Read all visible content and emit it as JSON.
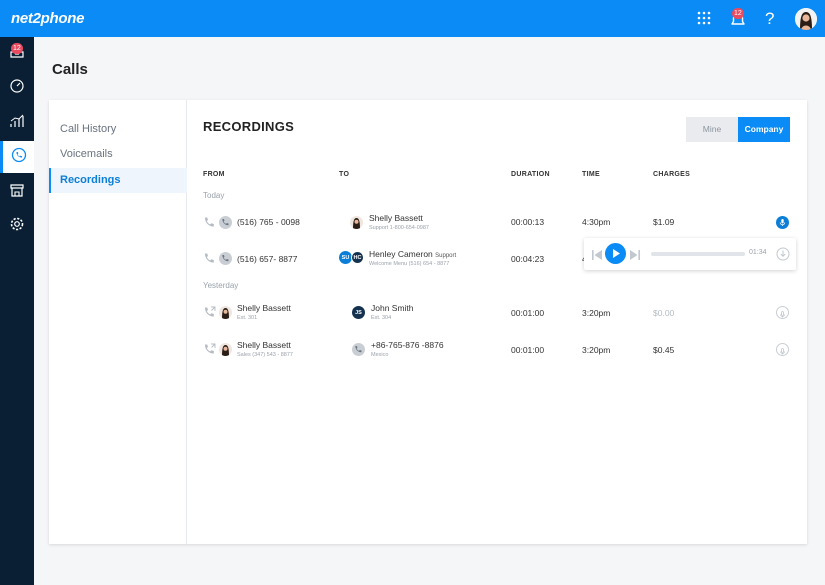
{
  "header": {
    "logo": "net2phone",
    "notification_count": "12",
    "help_label": "?"
  },
  "sidebar": {
    "inbox_badge": "12"
  },
  "page": {
    "title": "Calls"
  },
  "subnav": {
    "items": [
      {
        "label": "Call History"
      },
      {
        "label": "Voicemails"
      },
      {
        "label": "Recordings"
      }
    ]
  },
  "recordings": {
    "title": "RECORDINGS",
    "toggle": {
      "mine": "Mine",
      "company": "Company"
    },
    "columns": {
      "from": "FROM",
      "to": "TO",
      "duration": "DURATION",
      "time": "TIME",
      "charges": "CHARGES"
    },
    "groups": {
      "today": "Today",
      "yesterday": "Yesterday"
    },
    "rows": [
      {
        "from_name": "(516) 765 - 0098",
        "from_sub": "",
        "to_name": "Shelly Bassett",
        "to_sub": "Support 1-800-654-0987",
        "duration": "00:00:13",
        "time": "4:30pm",
        "charges": "$1.09"
      },
      {
        "from_name": "(516) 657- 8877",
        "from_sub": "",
        "to_name": "Henley Cameron",
        "to_tag": "Support",
        "to_sub": "Welcome Menu (516) 654 - 8877",
        "to_initials_a": "SU",
        "to_initials_b": "HC",
        "duration": "00:04:23",
        "time": "4",
        "charges": ""
      },
      {
        "from_name": "Shelly Bassett",
        "from_sub": "Ext. 301",
        "to_name": "John Smith",
        "to_sub": "Ext. 304",
        "to_initials": "JS",
        "duration": "00:01:00",
        "time": "3:20pm",
        "charges": "$0.00"
      },
      {
        "from_name": "Shelly Bassett",
        "from_sub": "Sales (347) 543 - 8877",
        "to_name": "+86-765-876 -8876",
        "to_sub": "Mexico",
        "duration": "00:01:00",
        "time": "3:20pm",
        "charges": "$0.45"
      }
    ]
  },
  "player": {
    "time": "01:34",
    "progress": 0.0
  },
  "colors": {
    "brand": "#0b8bf5",
    "sidebar": "#0a1f33",
    "badge": "#e84a5f"
  },
  "icons": [
    "grid-icon",
    "bell-icon",
    "help-icon",
    "inbox-icon",
    "dashboard-icon",
    "analytics-icon",
    "phone-icon",
    "store-icon",
    "settings-icon",
    "microphone-icon",
    "play-icon",
    "skip-back-icon",
    "skip-forward-icon",
    "download-icon"
  ]
}
